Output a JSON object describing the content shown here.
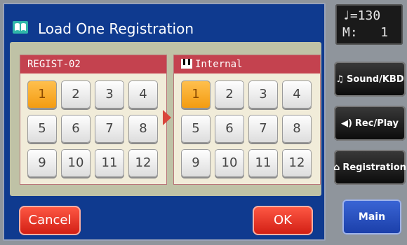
{
  "dialog": {
    "title": "Load One Registration"
  },
  "source": {
    "name": "REGIST-02",
    "selected": "1",
    "keys": [
      "1",
      "2",
      "3",
      "4",
      "5",
      "6",
      "7",
      "8",
      "9",
      "10",
      "11",
      "12"
    ]
  },
  "destination": {
    "name": "Internal",
    "selected": "1",
    "keys": [
      "1",
      "2",
      "3",
      "4",
      "5",
      "6",
      "7",
      "8",
      "9",
      "10",
      "11",
      "12"
    ]
  },
  "buttons": {
    "cancel": "Cancel",
    "ok": "OK"
  },
  "status": {
    "tempo": "=130",
    "measure_label": "M:",
    "measure_value": "1"
  },
  "side": {
    "sound": "Sound/KBD",
    "rec": "Rec/Play",
    "registration": "Registration",
    "main": "Main"
  },
  "colors": {
    "dialog_bg": "#0f3a8f",
    "selected_key": "#f39b10",
    "panel_header": "#c4424f",
    "action_red": "#d01c12"
  }
}
